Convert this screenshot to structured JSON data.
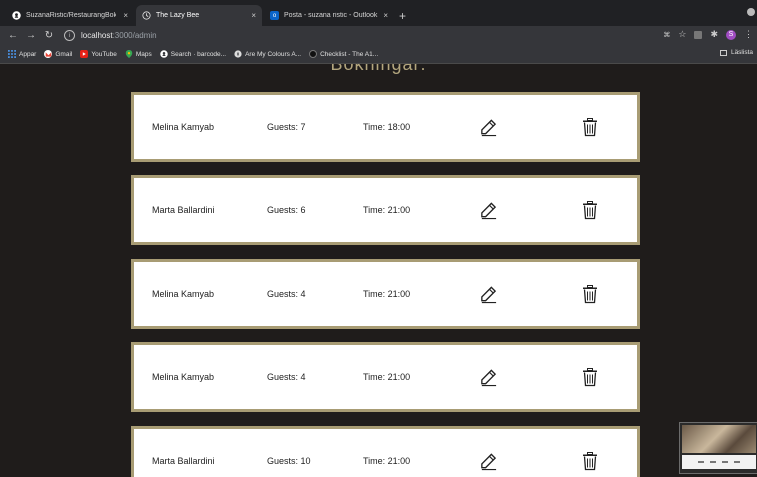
{
  "browser": {
    "tabs": [
      {
        "title": "SuzanaRistic/RestaurangBokni",
        "icon": "github-icon"
      },
      {
        "title": "The Lazy Bee",
        "icon": "globe-icon"
      },
      {
        "title": "Posta - suzana ristic - Outlook",
        "icon": "outlook-icon"
      }
    ],
    "close_glyph": "×",
    "new_tab_glyph": "+",
    "address": {
      "host": "localhost",
      "path": ":3000/admin"
    },
    "profile_initial": "S",
    "bookmarks": [
      {
        "label": "Appar",
        "icon": "apps-grid-icon"
      },
      {
        "label": "Gmail",
        "icon": "gmail-icon"
      },
      {
        "label": "YouTube",
        "icon": "youtube-icon"
      },
      {
        "label": "Maps",
        "icon": "maps-icon"
      },
      {
        "label": "Search · barcode...",
        "icon": "github-icon"
      },
      {
        "label": "Are My Colours A...",
        "icon": "compass-icon"
      },
      {
        "label": "Checklist - The A1...",
        "icon": "circle-icon"
      }
    ],
    "reading_list": "Läslista"
  },
  "page": {
    "heading": "Bokningar:"
  },
  "bookings": [
    {
      "name": "Melina Kamyab",
      "guests": "Guests: 7",
      "time": "Time: 18:00"
    },
    {
      "name": "Marta Ballardini",
      "guests": "Guests: 6",
      "time": "Time: 21:00"
    },
    {
      "name": "Melina Kamyab",
      "guests": "Guests: 4",
      "time": "Time: 21:00"
    },
    {
      "name": "Melina Kamyab",
      "guests": "Guests: 4",
      "time": "Time: 21:00"
    },
    {
      "name": "Marta Ballardini",
      "guests": "Guests: 10",
      "time": "Time: 21:00"
    }
  ],
  "colors": {
    "background": "#1f1c1b",
    "card_border": "#a89c74",
    "heading": "#b3a67e"
  }
}
